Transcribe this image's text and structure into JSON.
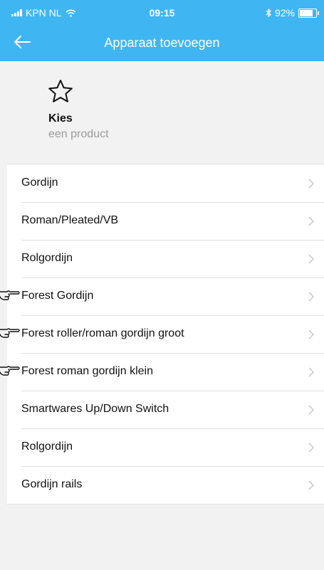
{
  "status_bar": {
    "carrier": "KPN NL",
    "time": "09:15",
    "battery": "92%",
    "battery_level": 0.92
  },
  "header": {
    "title": "Apparaat toevoegen"
  },
  "selection": {
    "title": "Kies",
    "subtitle": "een product"
  },
  "products": [
    {
      "label": "Gordijn",
      "highlighted": false
    },
    {
      "label": "Roman/Pleated/VB",
      "highlighted": false
    },
    {
      "label": "Rolgordijn",
      "highlighted": false
    },
    {
      "label": "Forest Gordijn",
      "highlighted": true
    },
    {
      "label": "Forest roller/roman gordijn groot",
      "highlighted": true
    },
    {
      "label": "Forest roman gordijn klein",
      "highlighted": true
    },
    {
      "label": "Smartwares Up/Down Switch",
      "highlighted": false
    },
    {
      "label": "Rolgordijn",
      "highlighted": false
    },
    {
      "label": "Gordijn rails",
      "highlighted": false
    }
  ],
  "colors": {
    "header": "#3fb6f2",
    "background": "#f2f2f2",
    "list_bg": "#ffffff",
    "chevron": "#c7c7cc"
  }
}
